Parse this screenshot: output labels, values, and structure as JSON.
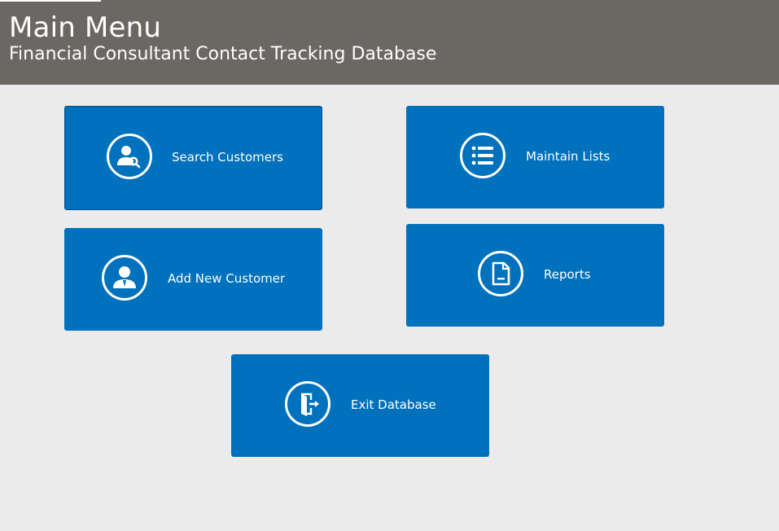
{
  "header": {
    "title": "Main Menu",
    "subtitle": "Financial Consultant Contact Tracking Database",
    "background": "#6b6762"
  },
  "menu": {
    "tile_color": "#0071bc",
    "search_customers": {
      "label": "Search Customers",
      "icon": "user-search-icon"
    },
    "maintain_lists": {
      "label": "Maintain Lists",
      "icon": "list-icon"
    },
    "add_new_customer": {
      "label": "Add New Customer",
      "icon": "user-add-icon"
    },
    "reports": {
      "label": "Reports",
      "icon": "document-icon"
    },
    "exit_database": {
      "label": "Exit Database",
      "icon": "exit-door-icon"
    }
  }
}
